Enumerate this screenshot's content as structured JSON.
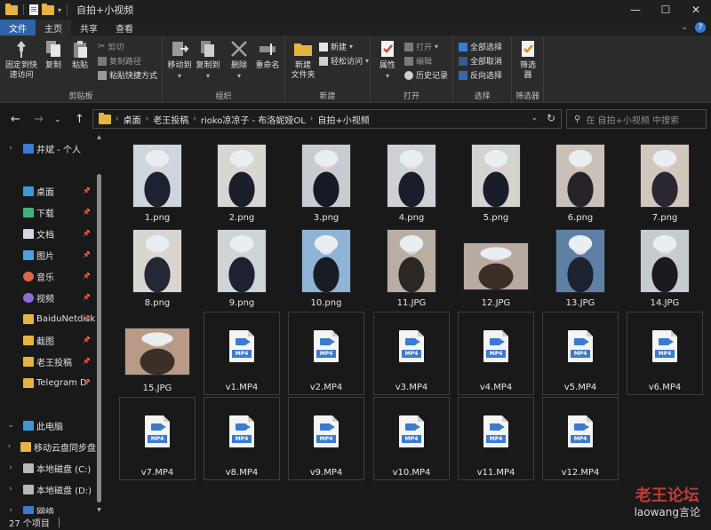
{
  "window": {
    "title": "自拍+小视频",
    "controls": {
      "minimize": "—",
      "maximize": "☐",
      "close": "✕"
    }
  },
  "tabs": [
    {
      "label": "文件"
    },
    {
      "label": "主页"
    },
    {
      "label": "共享"
    },
    {
      "label": "查看"
    }
  ],
  "ribbon": {
    "clipboard": {
      "label": "剪贴板",
      "pin": "固定到快\n速访问",
      "copy": "复制",
      "paste": "粘贴",
      "cut": "剪切",
      "copy_path": "复制路径",
      "paste_shortcut": "粘贴快捷方式"
    },
    "organize": {
      "label": "组织",
      "move_to": "移动到",
      "copy_to": "复制到",
      "delete": "删除",
      "rename": "重命名"
    },
    "new": {
      "label": "新建",
      "new_folder": "新建\n文件夹",
      "new_item": "新建",
      "easy_access": "轻松访问"
    },
    "open": {
      "label": "打开",
      "properties": "属性",
      "open": "打开",
      "edit": "编辑",
      "history": "历史记录"
    },
    "select": {
      "label": "选择",
      "select_all": "全部选择",
      "select_none": "全部取消",
      "invert": "反向选择"
    },
    "filter": {
      "label": "筛选器",
      "filter_btn": "筛选\n器"
    }
  },
  "address": {
    "crumbs": [
      "桌面",
      "老王投稿",
      "rioko凉凉子 - 布洛妮娅OL",
      "自拍+小视频"
    ],
    "search_placeholder": "在 自拍+小视频 中搜索"
  },
  "nav": [
    {
      "label": "井斌 - 个人",
      "icon": "cloud-icon",
      "chev": "›",
      "pin": false
    },
    {
      "label": "桌面",
      "icon": "desktop-icon",
      "pin": true
    },
    {
      "label": "下载",
      "icon": "download-icon",
      "pin": true
    },
    {
      "label": "文档",
      "icon": "document-icon",
      "pin": true
    },
    {
      "label": "图片",
      "icon": "pictures-icon",
      "pin": true
    },
    {
      "label": "音乐",
      "icon": "music-icon",
      "pin": true
    },
    {
      "label": "视频",
      "icon": "video-icon",
      "pin": true
    },
    {
      "label": "BaiduNetdisk",
      "icon": "folder-icon",
      "pin": true
    },
    {
      "label": "截图",
      "icon": "folder-icon",
      "pin": true
    },
    {
      "label": "老王投稿",
      "icon": "folder-icon",
      "pin": true
    },
    {
      "label": "Telegram D",
      "icon": "folder-icon",
      "pin": true
    },
    {
      "label": "此电脑",
      "icon": "pc-icon",
      "chev": "⌄",
      "pin": false
    },
    {
      "label": "移动云盘同步盘",
      "icon": "sync-drive-icon",
      "chev": "›",
      "pin": false
    },
    {
      "label": "本地磁盘 (C:)",
      "icon": "drive-icon",
      "chev": "›",
      "pin": false
    },
    {
      "label": "本地磁盘 (D:)",
      "icon": "drive-icon",
      "chev": "›",
      "pin": false
    },
    {
      "label": "网络",
      "icon": "network-icon",
      "chev": "›",
      "pin": false
    }
  ],
  "files": [
    {
      "name": "1.png",
      "type": "image",
      "thumb": [
        "#cfd5dc",
        "#1d2230",
        "#e7d6cc"
      ]
    },
    {
      "name": "2.png",
      "type": "image",
      "thumb": [
        "#d8d6d2",
        "#1c1f2b",
        "#e9dbd1"
      ]
    },
    {
      "name": "3.png",
      "type": "image",
      "thumb": [
        "#c8ccd2",
        "#171a24",
        "#e6d3c6"
      ]
    },
    {
      "name": "4.png",
      "type": "image",
      "thumb": [
        "#ced2d6",
        "#1b1e2a",
        "#eadad0"
      ]
    },
    {
      "name": "5.png",
      "type": "image",
      "thumb": [
        "#d4d3d0",
        "#1a1d29",
        "#e8d8cd"
      ]
    },
    {
      "name": "6.png",
      "type": "image",
      "thumb": [
        "#c9c1b7",
        "#26242a",
        "#e2cdbd"
      ]
    },
    {
      "name": "7.png",
      "type": "image",
      "thumb": [
        "#d1c8bd",
        "#2a2730",
        "#e6d2c3"
      ]
    },
    {
      "name": "8.png",
      "type": "image",
      "thumb": [
        "#d9d6d2",
        "#242734",
        "#e8d7cc"
      ]
    },
    {
      "name": "9.png",
      "type": "image",
      "thumb": [
        "#cfd4d8",
        "#1e2230",
        "#e5d6cd"
      ]
    },
    {
      "name": "10.png",
      "type": "image",
      "thumb": [
        "#8fb4d6",
        "#1a1c24",
        "#dfe4ea"
      ]
    },
    {
      "name": "11.JPG",
      "type": "image",
      "thumb": [
        "#b9aea4",
        "#2b2724",
        "#e3cfbf"
      ]
    },
    {
      "name": "12.JPG",
      "type": "image",
      "thumb": [
        "#b7aaa0",
        "#3a3029",
        "#d9c3b3"
      ]
    },
    {
      "name": "13.JPG",
      "type": "image",
      "thumb": [
        "#5f80a6",
        "#1d2230",
        "#dfe3e8"
      ]
    },
    {
      "name": "14.JPG",
      "type": "image",
      "thumb": [
        "#c6cbd0",
        "#1a1a1f",
        "#e6d6cc"
      ]
    },
    {
      "name": "15.JPG",
      "type": "image",
      "thumb": [
        "#b89a86",
        "#3b3028",
        "#e8d4c4"
      ]
    },
    {
      "name": "v1.MP4",
      "type": "video"
    },
    {
      "name": "v2.MP4",
      "type": "video"
    },
    {
      "name": "v3.MP4",
      "type": "video"
    },
    {
      "name": "v4.MP4",
      "type": "video"
    },
    {
      "name": "v5.MP4",
      "type": "video"
    },
    {
      "name": "v6.MP4",
      "type": "video"
    },
    {
      "name": "v7.MP4",
      "type": "video"
    },
    {
      "name": "v8.MP4",
      "type": "video"
    },
    {
      "name": "v9.MP4",
      "type": "video"
    },
    {
      "name": "v10.MP4",
      "type": "video"
    },
    {
      "name": "v11.MP4",
      "type": "video"
    },
    {
      "name": "v12.MP4",
      "type": "video"
    }
  ],
  "video_badge": "MP4",
  "status": {
    "count": "27 个项目"
  },
  "watermark": {
    "line1": "老王论坛",
    "line2": "laowang言论"
  },
  "colors": {
    "accent": "#2d64a8",
    "folder": "#e8b440",
    "video_icon": "#3b7bd0",
    "watermark": "#c23c36"
  }
}
